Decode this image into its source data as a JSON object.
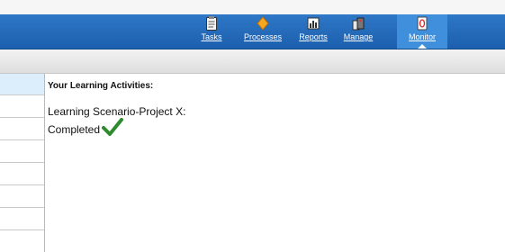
{
  "top_strip": {
    "fragment": ""
  },
  "nav": {
    "items": [
      {
        "label": "Tasks",
        "icon": "clipboard-icon",
        "active": false
      },
      {
        "label": "Processes",
        "icon": "diamond-icon",
        "active": false
      },
      {
        "label": "Reports",
        "icon": "report-icon",
        "active": false
      },
      {
        "label": "Manage",
        "icon": "manage-icon",
        "active": false
      },
      {
        "label": "Monitor",
        "icon": "monitor-icon",
        "active": true
      }
    ],
    "colors": {
      "bar": "#1c5fae",
      "active": "#3f8fdc"
    }
  },
  "content": {
    "heading": "Your Learning Activities:",
    "activity_title": "Learning Scenario-Project X:",
    "status": "Completed",
    "status_icon": "checkmark-icon",
    "status_color": "#2e8b2e"
  }
}
